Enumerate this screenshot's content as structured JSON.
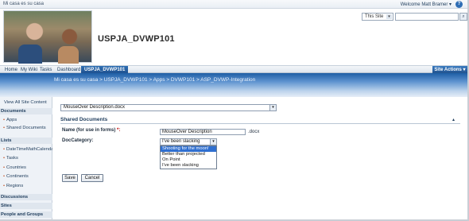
{
  "topbar": {
    "site_crumb": "Mi casa es su casa",
    "welcome": "Welcome Matt Bramer ▾",
    "help": "?"
  },
  "banner": {
    "site_title": "USPJA_DVWP101",
    "scope": "This Site",
    "search_button": "⌕"
  },
  "tabs": {
    "items": [
      "Home",
      "My Wiki",
      "Tasks",
      "Dashboard",
      "USPJA_DVWP101"
    ],
    "site_actions": "Site Actions ▾"
  },
  "breadcrumb": "Mi casa es su casa > USPJA_DVWP101 > Apps > DVWP101 > ASP_DVWP-Integration",
  "leftnav": {
    "view_all": "View All Site Content",
    "documents": "Documents",
    "doc_items": [
      "Apps",
      "Shared Documents"
    ],
    "lists": "Lists",
    "list_items": [
      "DateTimeMathCalendar",
      "Tasks",
      "Countries",
      "Continents",
      "Regions"
    ],
    "discussions": "Discussions",
    "sites": "Sites",
    "people": "People and Groups"
  },
  "form": {
    "file_select": "MouseOver Description.docx",
    "section_title": "Shared Documents",
    "section_toggle": "▴",
    "name_label": "Name (for use in forms)",
    "required_mark": " *:",
    "name_value": "MouseOver Description",
    "extension": ".docx",
    "category_label": "DocCategory:",
    "category_value": "I've been slacking",
    "category_options": [
      "Shooting for the moon!",
      "Better than projected",
      "On Point",
      "I've been slacking"
    ],
    "save": "Save",
    "cancel": "Cancel"
  }
}
